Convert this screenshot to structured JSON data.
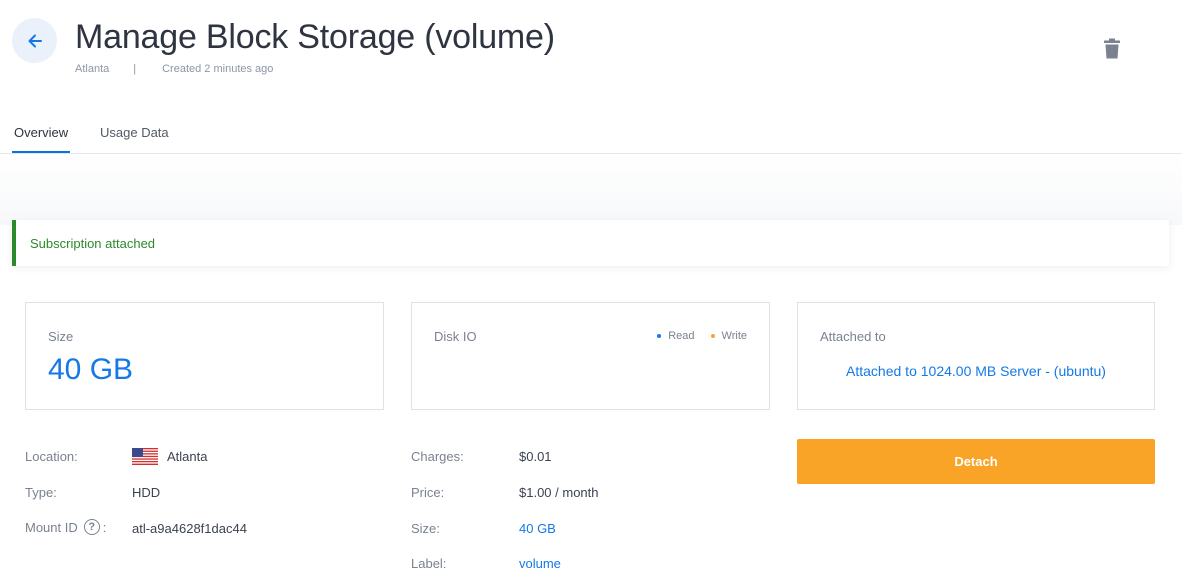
{
  "header": {
    "title": "Manage Block Storage (volume)",
    "location": "Atlanta",
    "separator": "|",
    "created": "Created 2 minutes ago"
  },
  "tabs": [
    {
      "label": "Overview",
      "active": true
    },
    {
      "label": "Usage Data",
      "active": false
    }
  ],
  "alert": {
    "text": "Subscription attached",
    "color": "#2b8a2b"
  },
  "cards": {
    "size": {
      "label": "Size",
      "value": "40 GB"
    },
    "disk_io": {
      "label": "Disk IO",
      "legend": [
        {
          "name": "Read",
          "color": "#1479e6"
        },
        {
          "name": "Write",
          "color": "#f9a427"
        }
      ]
    },
    "attached": {
      "label": "Attached to",
      "value": "Attached to 1024.00 MB Server - (ubuntu)"
    }
  },
  "details_left": [
    {
      "label": "Location:",
      "value": "Atlanta",
      "icon": "us-flag-icon"
    },
    {
      "label": "Type:",
      "value": "HDD"
    },
    {
      "label": "Mount ID",
      "suffix": ":",
      "value": "atl-a9a4628f1dac44",
      "help": "?"
    }
  ],
  "details_right": [
    {
      "label": "Charges:",
      "value": "$0.01"
    },
    {
      "label": "Price:",
      "value": "$1.00 / month"
    },
    {
      "label": "Size:",
      "value": "40 GB"
    },
    {
      "label": "Label:",
      "value": "volume"
    }
  ],
  "actions": {
    "detach_label": "Detach"
  },
  "colors": {
    "accent": "#1479e6",
    "warning": "#f9a427",
    "success": "#2b8a2b"
  }
}
